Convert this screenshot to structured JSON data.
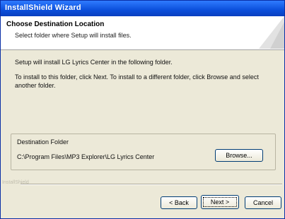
{
  "window": {
    "title": "InstallShield Wizard"
  },
  "header": {
    "title": "Choose Destination Location",
    "subtitle": "Select folder where Setup will install files."
  },
  "content": {
    "intro": "Setup will install LG Lyrics Center in the following folder.",
    "instructions": "To install to this folder, click Next. To install to a different folder, click Browse and select another folder."
  },
  "destination": {
    "label": "Destination Folder",
    "path": "C:\\Program Files\\MP3 Explorer\\LG Lyrics Center",
    "browse_label": "Browse..."
  },
  "footer": {
    "brand": "InstallShield",
    "back_label": "< Back",
    "next_label": "Next >",
    "cancel_label": "Cancel"
  },
  "colors": {
    "titlebar": "#0b4fdb",
    "dialog_bg": "#ece9d8"
  }
}
